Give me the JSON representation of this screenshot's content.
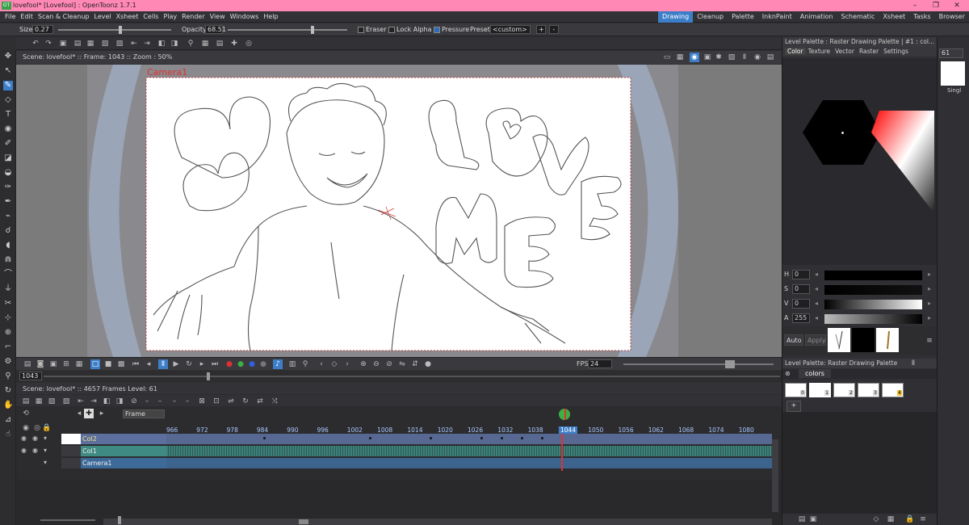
{
  "window": {
    "title": "lovefool* [Lovefool] : OpenToonz 1.7.1",
    "logo": "OT"
  },
  "menu": [
    "File",
    "Edit",
    "Scan & Cleanup",
    "Level",
    "Xsheet",
    "Cells",
    "Play",
    "Render",
    "View",
    "Windows",
    "Help"
  ],
  "rooms": [
    {
      "label": "Drawing",
      "active": true
    },
    {
      "label": "Cleanup"
    },
    {
      "label": "Palette"
    },
    {
      "label": "InknPaint"
    },
    {
      "label": "Animation"
    },
    {
      "label": "Schematic"
    },
    {
      "label": "Xsheet"
    },
    {
      "label": "Tasks"
    },
    {
      "label": "Browser"
    }
  ],
  "tool_options": {
    "size_label": "Size",
    "size_value": "0.27",
    "opacity_label": "Opacity",
    "opacity_value": "68.51",
    "eraser_label": "Eraser",
    "lock_alpha_label": "Lock Alpha",
    "pressure_label": "Pressure",
    "preset_label": "Preset:",
    "preset_value": "<custom>",
    "add": "+",
    "remove": "-",
    "eraser_checked": false,
    "lock_alpha_checked": false,
    "pressure_checked": true
  },
  "viewer": {
    "info": "Scene: lovefool*  ::  Frame: 1043  ::  Zoom : 50%",
    "camera_label": "Camera1"
  },
  "playback": {
    "fps_label": "FPS",
    "fps_value": "24"
  },
  "frame_field": "1043",
  "xsheet": {
    "info": "Scene: lovefool*  ::  4657 Frames  Level: 61",
    "frame_mode": "Frame",
    "current_frame": "1044",
    "ticks": [
      "966",
      "972",
      "978",
      "984",
      "990",
      "996",
      "1002",
      "1008",
      "1014",
      "1020",
      "1026",
      "1032",
      "1038",
      "1044",
      "1050",
      "1056",
      "1062",
      "1068",
      "1074",
      "1080"
    ],
    "columns": [
      {
        "name": "Col2",
        "color": "#5c6f9e"
      },
      {
        "name": "Col1",
        "color": "#3f8a83"
      },
      {
        "name": "Camera1",
        "color": "#3e6a9a"
      }
    ]
  },
  "level_palette": {
    "title": "Level Palette : Raster Drawing Palette | #1 : col...",
    "tabs": [
      "Color",
      "Texture",
      "Vector",
      "Raster",
      "Settings"
    ],
    "channels": [
      {
        "label": "H",
        "value": "0"
      },
      {
        "label": "S",
        "value": "0"
      },
      {
        "label": "V",
        "value": "0"
      },
      {
        "label": "A",
        "value": "255"
      }
    ],
    "auto": "Auto",
    "apply": "Apply"
  },
  "level_palette2": {
    "title": "Level Palette: Raster Drawing Palette",
    "page": "colors",
    "chips": [
      "0",
      "1",
      "2",
      "3",
      "4"
    ],
    "add": "+"
  },
  "far_right": {
    "level": "61",
    "label": "Singl"
  },
  "colors": {
    "accent": "#3d7ec9",
    "titlebar": "#ff88b4",
    "camera_red": "#e03030"
  }
}
